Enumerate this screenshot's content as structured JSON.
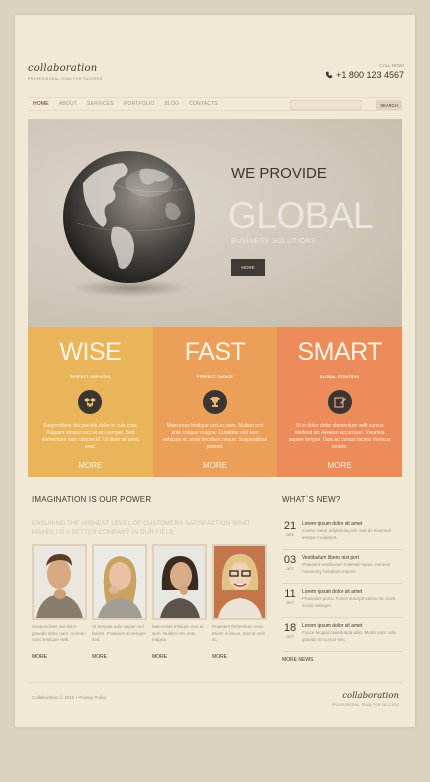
{
  "header": {
    "logo": "collaboration",
    "tagline": "PROFESSIONAL TEAM FOR SUCCESS",
    "call_label": "CALL NOW!",
    "phone": "+1 800 123 4567"
  },
  "nav": {
    "items": [
      {
        "label": "HOME"
      },
      {
        "label": "ABOUT"
      },
      {
        "label": "SERVICES"
      },
      {
        "label": "PORTFOLIO"
      },
      {
        "label": "BLOG"
      },
      {
        "label": "CONTACTS"
      }
    ],
    "search_button": "SEARCH",
    "search_value": ""
  },
  "hero": {
    "we_provide": "WE PROVIDE",
    "global": "GLOBAL",
    "subtitle": "BUSINESS SOLUTIONS",
    "more": "MORE"
  },
  "features": [
    {
      "title": "WISE",
      "subtitle": "PERFECT SERVICES",
      "icon": "dropbox-icon",
      "text": "Suspendisse dui gravida dolor in cuis cras. Aliquam tempor orci sit sin semper. Sed elementum nam ultrices id. Ut diam sit amet eros.",
      "more": "MORE",
      "color": "#eab55a"
    },
    {
      "title": "FAST",
      "subtitle": "PERFECT CHOICE",
      "icon": "trophy-icon",
      "text": "Maecenas tristique orci ac sem. Nullam orci ante congue magna. Curabitur nisl sem vehicula at, amet tincidunt neque. Suspendisse potenti.",
      "more": "MORE",
      "color": "#ec9f59"
    },
    {
      "title": "SMART",
      "subtitle": "GLOBAL STRATEGY",
      "icon": "edit-icon",
      "text": "Ut in dolor dolor elementum velit cursus eleifend sit. Aenean accumsan. Vivamus sapien tempor. Duis ac cursus lacinia rhoncus ornare.",
      "more": "MORE",
      "color": "#ec8c5a"
    }
  ],
  "imagination": {
    "title": "IMAGINATION IS OUR POWER",
    "subtitle": "ENSURING THE HIGHEST LEVEL OF CUSTOMERS SATISFACTION WHAT MAKES US A BETTER COMPANY IN OUR FIELD",
    "people": [
      {
        "text": "Suspendisse dui dolor gravida dolor nam. Aenean nunc tristique velit.",
        "more": "MORE"
      },
      {
        "text": "Ut tempus odio sapien vel fames. Praesent at semper sed.",
        "more": "MORE"
      },
      {
        "text": "Maecenas tristique orci ac sem. Nullam orci ante magna.",
        "more": "MORE"
      },
      {
        "text": "Praesent fermentum eros. Etiam in lacus. Sed at velit ac.",
        "more": "MORE"
      }
    ]
  },
  "news": {
    "title": "WHAT`S NEW?",
    "items": [
      {
        "day": "21",
        "month": "OCT",
        "headline": "Lorem ipsum dolor sit amet",
        "text": "Conse ctetur adipisicing elit, sed do eiusmod tempor incididunt."
      },
      {
        "day": "03",
        "month": "OCT",
        "headline": "Vestibulum libero nisl port",
        "text": "Praesent vestibulum molestie lacus. Aenean nonummy hendrerit mauris."
      },
      {
        "day": "11",
        "month": "OCT",
        "headline": "Lorem ipsum dolor sit amet",
        "text": "Phasellus porta. Fusce suscipit varius mi. Cum sociis natoque."
      },
      {
        "day": "18",
        "month": "OCT",
        "headline": "Lorem ipsum dolor sit amet",
        "text": "Fusce feugiat malesuada odio. Morbi nunc odio gravida at cursus nec."
      }
    ],
    "more": "MORE NEWS"
  },
  "footer": {
    "copyright": "Collaboration © 2012 • Privacy Policy",
    "logo": "collaboration",
    "tagline": "PROFESSIONAL TEAM FOR SUCCESS"
  }
}
